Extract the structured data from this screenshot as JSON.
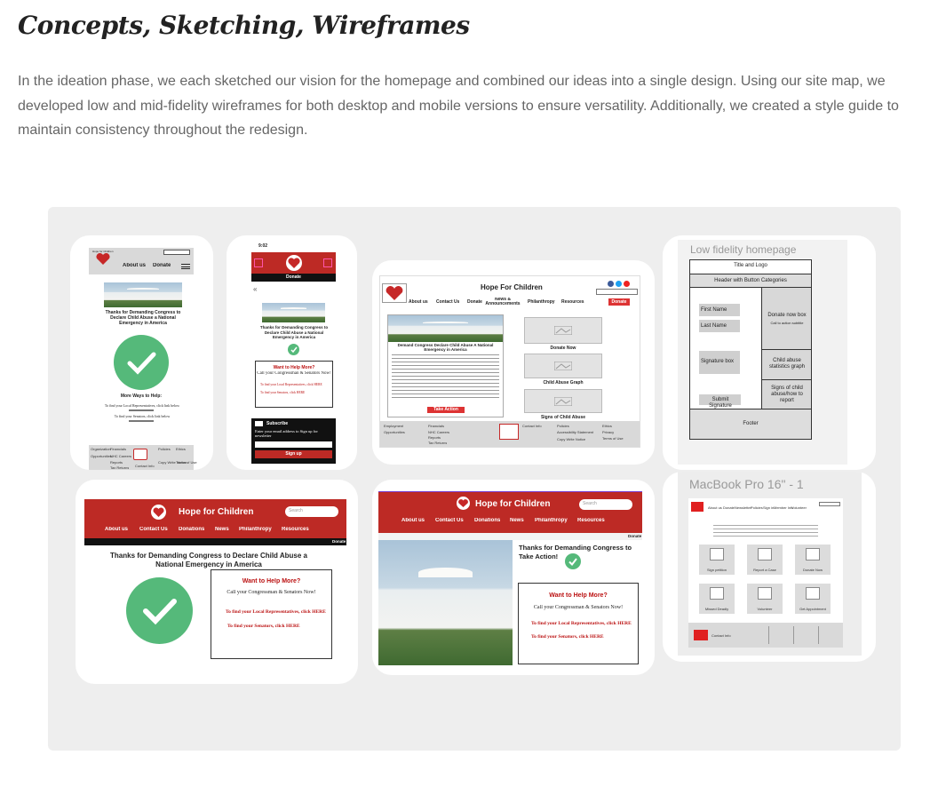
{
  "page": {
    "title": "Concepts, Sketching, Wireframes",
    "intro": "In the ideation phase, we each sketched our vision for the homepage and combined our ideas into a single design. Using our site map, we developed low and mid-fidelity wireframes for both desktop and mobile versions to ensure versatility. Additionally, we created a style guide to maintain consistency throughout the redesign."
  },
  "colors": {
    "brand_red": "#bd2a25",
    "check_green": "#55b97a",
    "board_bg": "#eeeeee"
  },
  "mobile1": {
    "logo_text": "Hope for Children",
    "nav": [
      "About us",
      "Donate"
    ],
    "headline": "Thanks for Demanding Congress to Declare Child Abuse a National Emergency in America",
    "more_ways": "More Ways to Help:",
    "line1": "To find your Local Representatives, click link below",
    "line2": "To find your Senators, click link below",
    "footer_cols": [
      "Organization",
      "Financials",
      "Policies",
      "Ethics",
      "Opportunities",
      "NHC Careers",
      "Accessibility Statement",
      "Privacy",
      "Reports",
      "Copy Write Notice",
      "Terms of Use",
      "Tax Returns",
      "Contact Info"
    ]
  },
  "mobile2": {
    "time": "9:02",
    "donate": "Donate",
    "headline": "Thanks for Demanding Congress to Declare Child Abuse a National Emergency in America",
    "help_title": "Want to Help More?",
    "help_sub": "Call your Congressman & Senators Now!",
    "link1": "To find your Local Representatives, click HERE",
    "link2": "To find your Senators, click HERE",
    "subscribe_title": "Subscribe",
    "subscribe_text": "Enter your email address to Sign up for newsletter",
    "signup": "Sign up"
  },
  "desktop1": {
    "title": "Hope For Children",
    "logo_text": "Hope for Children",
    "nav": [
      "About us",
      "Contact Us",
      "Donate",
      "News & Announcements",
      "Philanthropy",
      "Resources"
    ],
    "donate_btn": "Donate",
    "headline": "Demand Congress Declare Child Abuse A National Emergency in America",
    "cta": "Take Action",
    "tiles": [
      "Donate Now",
      "Child Abuse Graph",
      "Signs of Child Abuse"
    ],
    "footer_cols": [
      "Employment",
      "Financials",
      "Policies",
      "Ethics",
      "Opportunities",
      "NHC Careers",
      "Accessibility Statement",
      "Privacy",
      "Reports",
      "Copy Write Notice",
      "Terms of Use",
      "Tax Returns",
      "Contact Info"
    ]
  },
  "lowfi": {
    "title": "Low fidelity homepage",
    "title_logo": "Title and Logo",
    "header": "Header with Button Categories",
    "first_name": "First Name",
    "last_name": "Last Name",
    "donate_box": "Donate now box",
    "donate_sub": "Call to action subtitle",
    "signature_box": "Signature box",
    "graph": "Child abuse statistics graph",
    "submit": "Submit Signature",
    "signs": "Signs of child abuse/how to report",
    "footer": "Footer"
  },
  "desktop2": {
    "title": "Hope for Children",
    "search": "Search",
    "nav": [
      "About us",
      "Contact Us",
      "Donations",
      "News",
      "Philanthropy",
      "Resources"
    ],
    "donate": "Donate",
    "headline": "Thanks for Demanding Congress to Declare Child Abuse a National Emergency in America",
    "help_title": "Want to Help More?",
    "help_sub": "Call your Congressman & Senators Now!",
    "link1": "To find your Local Representatives, click HERE",
    "link2": "To find your Senators, click HERE"
  },
  "desktop3": {
    "title": "Hope for Children",
    "search": "Search",
    "nav": [
      "About us",
      "Contact Us",
      "Donations",
      "News",
      "Philanthropy",
      "Resources"
    ],
    "donate": "Donate",
    "headline": "Thanks for Demanding Congress to Take Action!",
    "help_title": "Want to Help More?",
    "help_sub": "Call your Congressman & Senators Now!",
    "link1": "To find your Local Representatives, click HERE",
    "link2": "To find your Senators, click HERE"
  },
  "macbook": {
    "title": "MacBook Pro 16\" - 1",
    "nav": [
      "About us",
      "Donate",
      "Newsletter",
      "Policies",
      "Sign in",
      "Member Info",
      "Volunteer"
    ],
    "tiles": [
      "Sign petition",
      "Report a Case",
      "Donate Now",
      "Missed Deadly",
      "Volunteer",
      "Get Appointment"
    ],
    "footer_label": "Contact Info"
  }
}
